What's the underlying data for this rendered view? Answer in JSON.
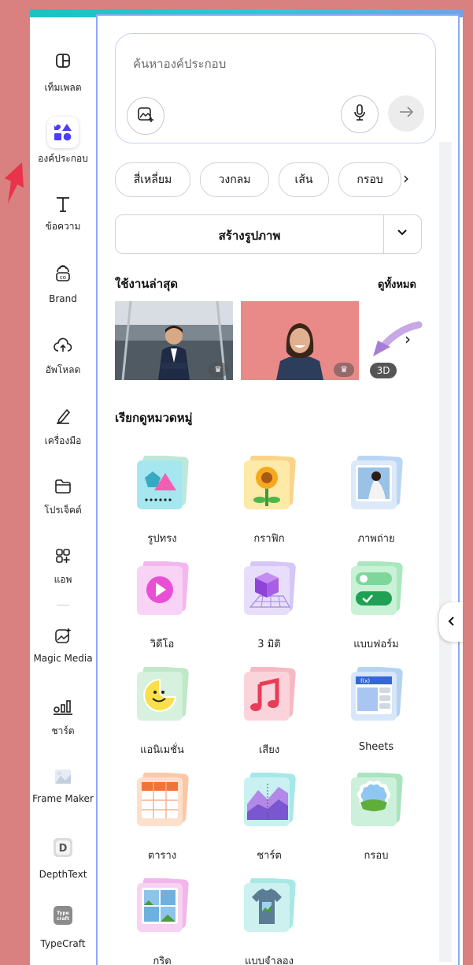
{
  "sidebar": {
    "items": [
      {
        "label": "เท็มเพลต",
        "icon": "layout-icon"
      },
      {
        "label": "องค์ประกอบ",
        "icon": "shapes-icon",
        "active": true
      },
      {
        "label": "ข้อความ",
        "icon": "text-icon"
      },
      {
        "label": "Brand",
        "icon": "brand-icon"
      },
      {
        "label": "อัพโหลด",
        "icon": "upload-cloud-icon"
      },
      {
        "label": "เครื่องมือ",
        "icon": "pen-icon"
      },
      {
        "label": "โปรเจ็คต์",
        "icon": "folder-icon"
      },
      {
        "label": "แอพ",
        "icon": "apps-icon"
      },
      {
        "label": "Magic Media",
        "icon": "magic-media-icon"
      },
      {
        "label": "ชาร์ต",
        "icon": "chart-icon"
      },
      {
        "label": "Frame Maker",
        "icon": "frame-maker-icon"
      },
      {
        "label": "DepthText",
        "icon": "depthtext-icon"
      },
      {
        "label": "TypeCraft",
        "icon": "typecraft-icon"
      }
    ]
  },
  "search": {
    "placeholder": "ค้นหาองค์ประกอบ"
  },
  "chips": [
    "สี่เหลี่ยม",
    "วงกลม",
    "เส้น",
    "กรอบ"
  ],
  "create_image": {
    "label": "สร้างรูปภาพ"
  },
  "recent": {
    "title": "ใช้งานล่าสุด",
    "see_all": "ดูทั้งหมด",
    "badge": "3D"
  },
  "categories": {
    "title": "เรียกดูหมวดหมู่",
    "items": [
      {
        "label": "รูปทรง",
        "icon": "shapes-category-icon"
      },
      {
        "label": "กราฟิก",
        "icon": "sunflower-graphic-icon"
      },
      {
        "label": "ภาพถ่าย",
        "icon": "photo-icon"
      },
      {
        "label": "วิดีโอ",
        "icon": "video-play-icon"
      },
      {
        "label": "3 มิติ",
        "icon": "cube-3d-icon"
      },
      {
        "label": "แบบฟอร์ม",
        "icon": "form-toggle-icon"
      },
      {
        "label": "แอนิเมชั่น",
        "icon": "sticker-smiley-icon"
      },
      {
        "label": "เสียง",
        "icon": "music-note-icon"
      },
      {
        "label": "Sheets",
        "icon": "sheets-fx-icon"
      },
      {
        "label": "ตาราง",
        "icon": "table-icon"
      },
      {
        "label": "ชาร์ต",
        "icon": "area-chart-icon"
      },
      {
        "label": "กรอบ",
        "icon": "frame-cloud-icon"
      },
      {
        "label": "กริด",
        "icon": "grid-icon"
      },
      {
        "label": "แบบจำลอง",
        "icon": "tshirt-mockup-icon"
      }
    ]
  },
  "colors": {
    "panel_border": "#8da8f5",
    "accent_teal": "#17c4c0",
    "background": "#d98080"
  },
  "misc": {
    "depthtext_letter": "D",
    "typecraft_text": "Type craft"
  }
}
